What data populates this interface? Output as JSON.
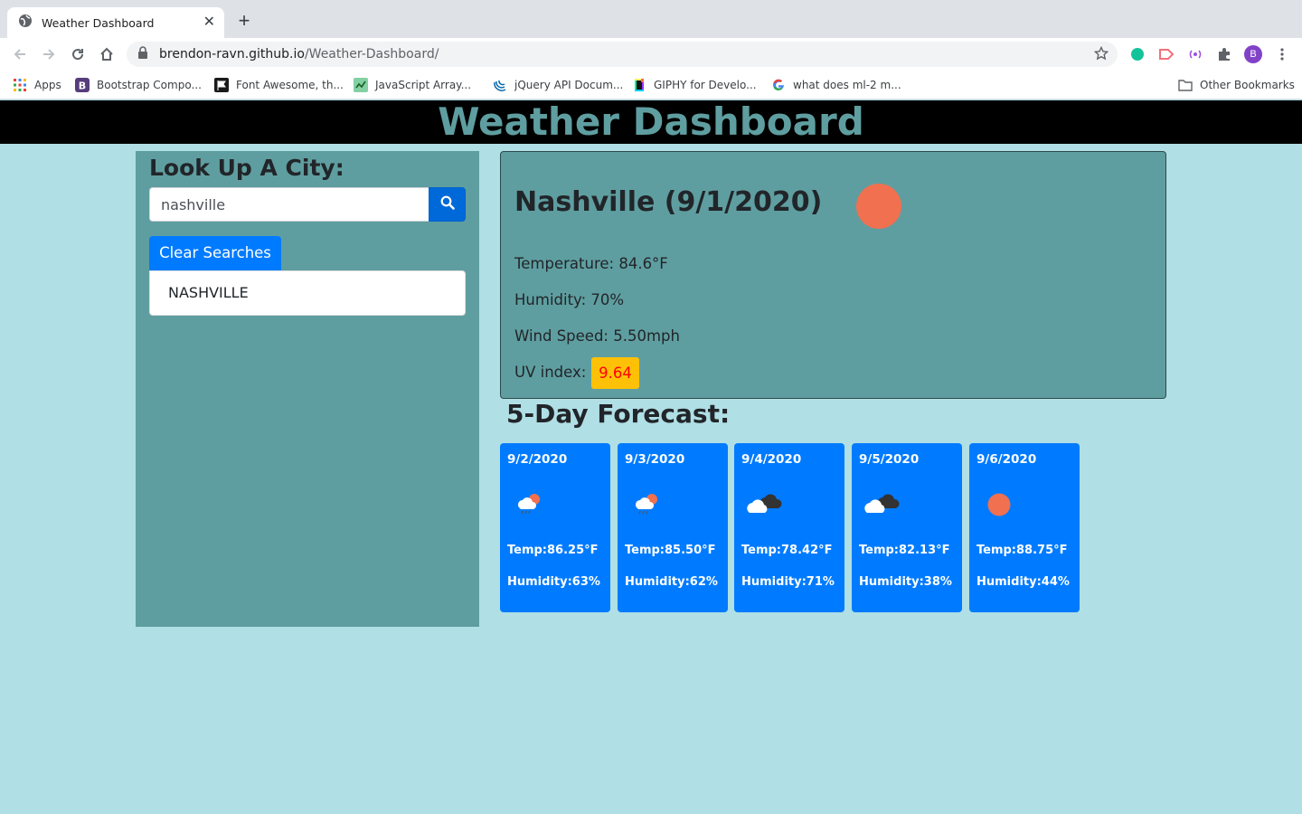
{
  "browser": {
    "tab_title": "Weather Dashboard",
    "url_host": "brendon-ravn.github.io",
    "url_path": "/Weather-Dashboard/",
    "avatar_letter": "B",
    "bookmarks": [
      {
        "label": "Apps",
        "icon": "apps-grid-icon"
      },
      {
        "label": "Bootstrap Compo...",
        "icon": "bootstrap-icon"
      },
      {
        "label": "Font Awesome, th...",
        "icon": "font-awesome-icon"
      },
      {
        "label": "JavaScript Array...",
        "icon": "javascript-icon"
      },
      {
        "label": "jQuery API Docum...",
        "icon": "jquery-icon"
      },
      {
        "label": "GIPHY for Develo...",
        "icon": "giphy-icon"
      },
      {
        "label": "what does ml-2 m...",
        "icon": "google-icon"
      }
    ],
    "other_bookmarks": "Other Bookmarks"
  },
  "header": {
    "title": "Weather Dashboard"
  },
  "sidebar": {
    "heading": "Look Up A City:",
    "search_value": "nashville",
    "clear_label": "Clear Searches",
    "history": [
      "NASHVILLE"
    ]
  },
  "current": {
    "city_title": "Nashville (9/1/2020)",
    "icon": "sun-icon",
    "temperature": "Temperature: 84.6°F",
    "humidity": "Humidity: 70%",
    "wind": "Wind Speed: 5.50mph",
    "uv_label": "UV index:",
    "uv_value": "9.64",
    "uv_color": "#ffc107"
  },
  "forecast": {
    "heading": "5-Day Forecast:",
    "days": [
      {
        "date": "9/2/2020",
        "icon": "cloud-sun-rain-icon",
        "temp": "Temp:86.25°F",
        "humidity": "Humidity:63%"
      },
      {
        "date": "9/3/2020",
        "icon": "cloud-sun-rain-icon",
        "temp": "Temp:85.50°F",
        "humidity": "Humidity:62%"
      },
      {
        "date": "9/4/2020",
        "icon": "broken-clouds-icon",
        "temp": "Temp:78.42°F",
        "humidity": "Humidity:71%"
      },
      {
        "date": "9/5/2020",
        "icon": "broken-clouds-icon",
        "temp": "Temp:82.13°F",
        "humidity": "Humidity:38%"
      },
      {
        "date": "9/6/2020",
        "icon": "sun-icon",
        "temp": "Temp:88.75°F",
        "humidity": "Humidity:44%"
      }
    ]
  },
  "colors": {
    "page_bg": "#b0dfe5",
    "panel": "#5f9ea0",
    "primary": "#007bff",
    "sun": "#f07050"
  }
}
